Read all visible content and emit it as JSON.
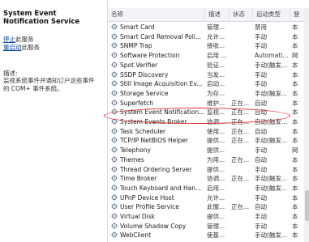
{
  "detail": {
    "title": "System Event Notification Service",
    "stop_link": "停止",
    "stop_suffix": "此服务",
    "restart_link": "重启动",
    "restart_suffix": "此服务",
    "desc_heading": "描述:",
    "description": "监视系统事件并通知订户这些事件的 COM+ 事件系统。"
  },
  "columns": {
    "name": "名称",
    "desc": "描述",
    "status": "状态",
    "startup": "启动类型",
    "logon": "登"
  },
  "services": [
    {
      "name": "Smart Card",
      "desc": "管理...",
      "status": "",
      "startup": "禁用",
      "logon": "本"
    },
    {
      "name": "Smart Card Removal Poli...",
      "desc": "允许...",
      "status": "",
      "startup": "手动",
      "logon": "本"
    },
    {
      "name": "SNMP Trap",
      "desc": "接收...",
      "status": "",
      "startup": "手动",
      "logon": "本"
    },
    {
      "name": "Software Protection",
      "desc": "启用 ...",
      "status": "",
      "startup": "Automati...",
      "logon": "网"
    },
    {
      "name": "Spot Verifier",
      "desc": "验证...",
      "status": "",
      "startup": "手动(触发...",
      "logon": "本"
    },
    {
      "name": "SSDP Discovery",
      "desc": "当发...",
      "status": "",
      "startup": "手动",
      "logon": "本"
    },
    {
      "name": "Still Image Acquisition Ev...",
      "desc": "启动...",
      "status": "",
      "startup": "手动",
      "logon": "本"
    },
    {
      "name": "Storage Service",
      "desc": "为存...",
      "status": "",
      "startup": "手动(触发...",
      "logon": "本"
    },
    {
      "name": "Superfetch",
      "desc": "维护...",
      "status": "正在...",
      "startup": "自动",
      "logon": "本"
    },
    {
      "name": "System Event Notification...",
      "desc": "监视...",
      "status": "正在...",
      "startup": "自动",
      "logon": "本"
    },
    {
      "name": "System Events Broker",
      "desc": "协调...",
      "status": "正在...",
      "startup": "自动(触发...",
      "logon": "本"
    },
    {
      "name": "Task Scheduler",
      "desc": "使用...",
      "status": "正在...",
      "startup": "自动",
      "logon": "本"
    },
    {
      "name": "TCP/IP NetBIOS Helper",
      "desc": "提供...",
      "status": "正在...",
      "startup": "手动(触发...",
      "logon": "本"
    },
    {
      "name": "Telephony",
      "desc": "提供...",
      "status": "",
      "startup": "手动",
      "logon": "网"
    },
    {
      "name": "Themes",
      "desc": "为用...",
      "status": "正在...",
      "startup": "自动",
      "logon": "本"
    },
    {
      "name": "Thread Ordering Server",
      "desc": "提供...",
      "status": "",
      "startup": "手动",
      "logon": "本"
    },
    {
      "name": "Time Broker",
      "desc": "协调...",
      "status": "正在...",
      "startup": "手动(触发...",
      "logon": "本"
    },
    {
      "name": "Touch Keyboard and Han...",
      "desc": "启用...",
      "status": "",
      "startup": "手动(触发...",
      "logon": "本"
    },
    {
      "name": "UPnP Device Host",
      "desc": "允许...",
      "status": "",
      "startup": "手动",
      "logon": "本"
    },
    {
      "name": "User Profile Service",
      "desc": "此服...",
      "status": "正在...",
      "startup": "自动",
      "logon": "本"
    },
    {
      "name": "Virtual Disk",
      "desc": "提供...",
      "status": "",
      "startup": "手动",
      "logon": "本"
    },
    {
      "name": "Volume Shadow Copy",
      "desc": "管理...",
      "status": "",
      "startup": "手动",
      "logon": "本"
    },
    {
      "name": "WebClient",
      "desc": "使基...",
      "status": "",
      "startup": "手动(触发...",
      "logon": "本"
    }
  ],
  "annotation": {
    "color": "#e02b2b",
    "highlighted_service": "System Event Notification..."
  }
}
